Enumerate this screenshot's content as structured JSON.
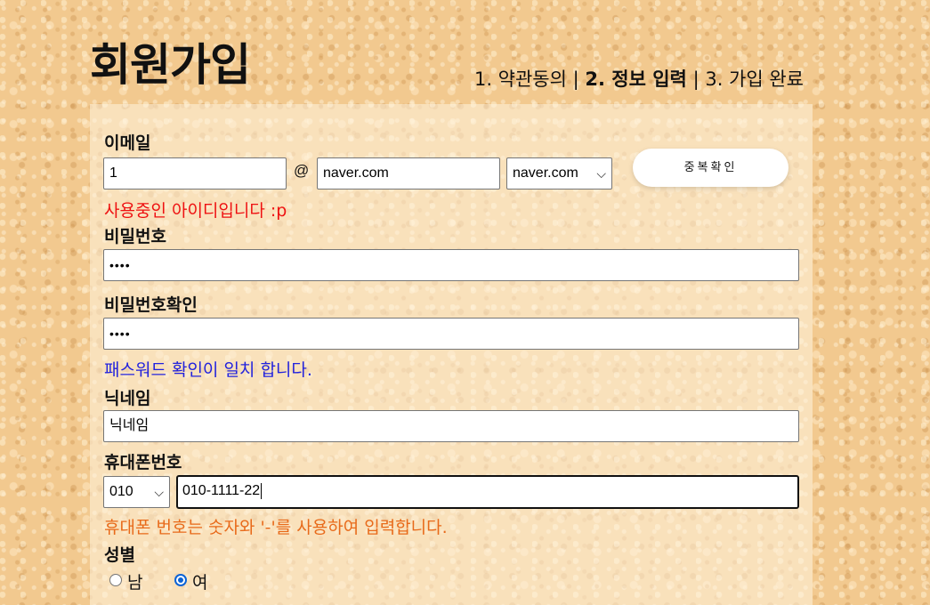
{
  "header": {
    "title": "회원가입",
    "step1": "1. 약관동의 |",
    "step2": "2. 정보 입력",
    "step3": "| 3. 가입 완료"
  },
  "form": {
    "email": {
      "label": "이메일",
      "local_value": "1",
      "at": "@",
      "domain_value": "naver.com",
      "domain_select": "naver.com",
      "check_button": "중복확인",
      "message": "사용중인 아이디입니다 :p",
      "message_color": "#ee1111"
    },
    "password": {
      "label": "비밀번호",
      "value": "••••"
    },
    "password_confirm": {
      "label": "비밀번호확인",
      "value": "••••",
      "message": "패스워드 확인이 일치 합니다.",
      "message_color": "#2222dd"
    },
    "nickname": {
      "label": "닉네임",
      "value": "닉네임"
    },
    "phone": {
      "label": "휴대폰번호",
      "prefix_select": "010",
      "value": "010-1111-22",
      "message": "휴대폰 번호는 숫자와 '-'를 사용하여 입력합니다.",
      "message_color": "#e86a1a"
    },
    "gender": {
      "label": "성별",
      "option_male": "남",
      "option_female": "여",
      "selected": "여"
    }
  }
}
